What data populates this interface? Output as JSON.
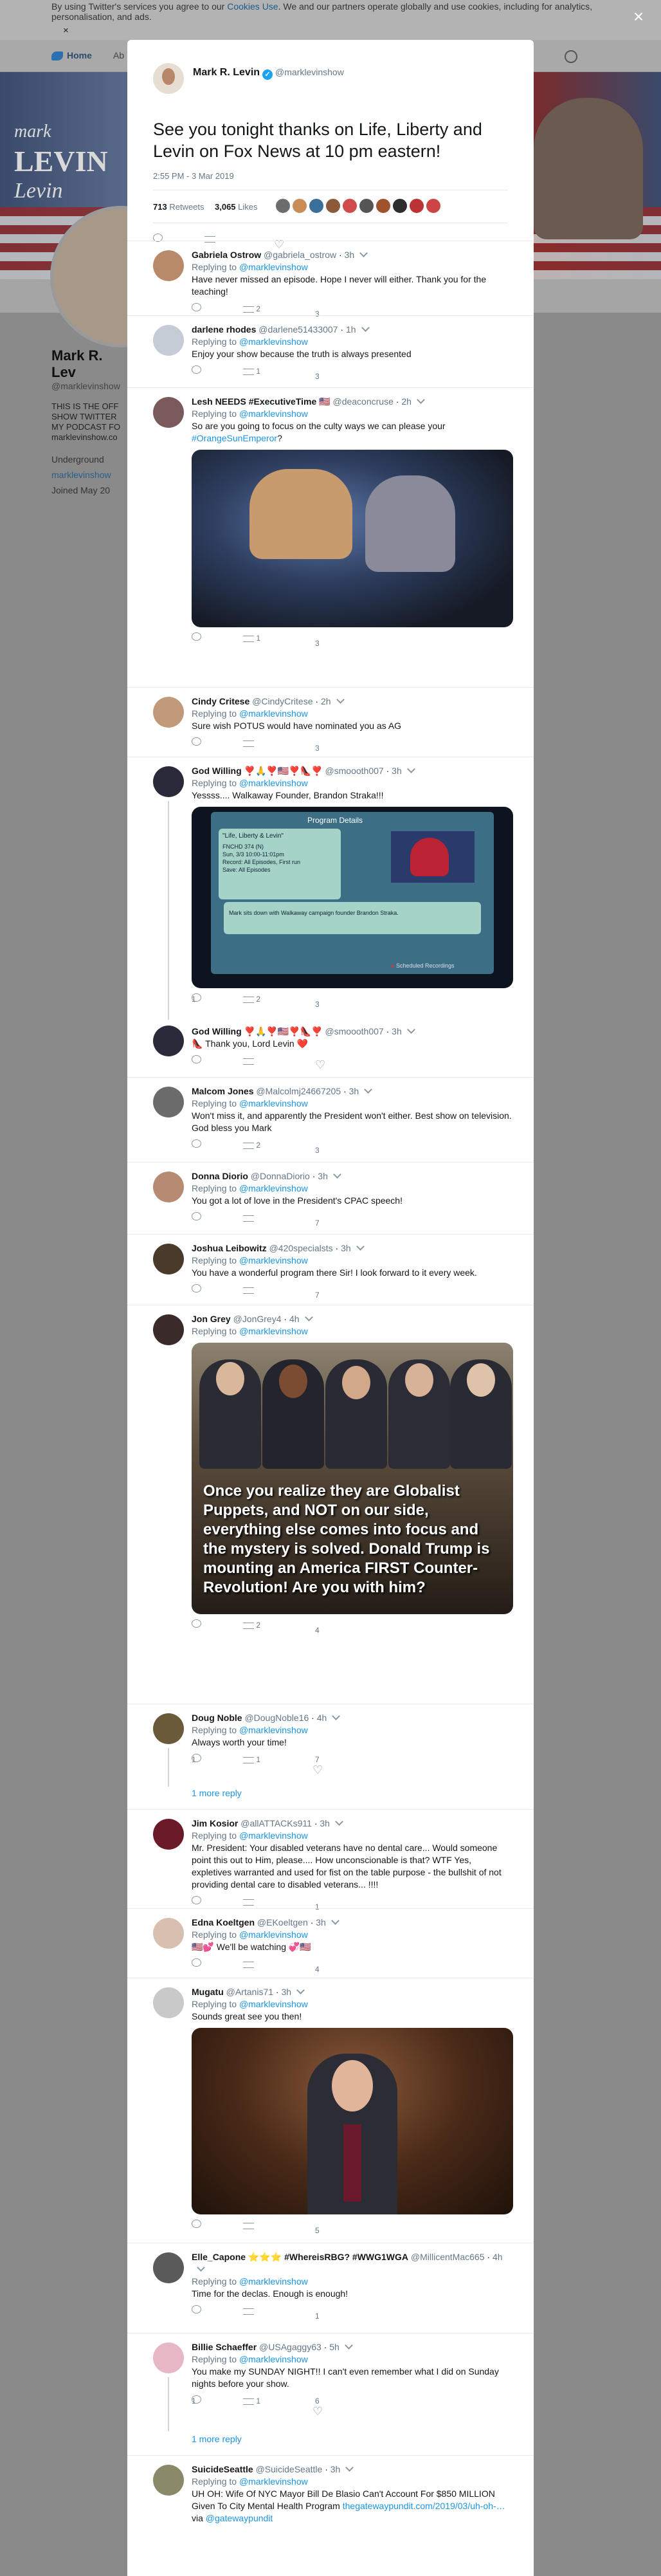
{
  "cookie_banner": {
    "text_before": "By using Twitter's services you agree to our ",
    "link": "Cookies Use",
    "text_after": ". We and our partners operate globally and use cookies, including for analytics, personalisation, and ads.",
    "close": "×"
  },
  "nav": {
    "home": "Home",
    "abbr": "Ab"
  },
  "background_profile": {
    "logo_line1": "mark",
    "logo_line2": "LEVIN",
    "logo_line3": "Levin",
    "name": "Mark R. Lev",
    "handle": "@marklevinshow",
    "bio": "THIS IS THE OFF SHOW TWITTER MY PODCAST FO marklevinshow.co",
    "location": "Underground",
    "site": "marklevinshow",
    "joined": "Joined May 20"
  },
  "modal_close": "×",
  "main_tweet": {
    "name": "Mark R. Levin",
    "handle": "@marklevinshow",
    "text": "See you tonight thanks on Life, Liberty and Levin on Fox News at 10 pm eastern!",
    "time": "2:55 PM - 3 Mar 2019",
    "retweets_count": "713",
    "retweets_label": "Retweets",
    "likes_count": "3,065",
    "likes_label": "Likes",
    "liker_colors": [
      "#6d6d6d",
      "#c98d5a",
      "#3a6f9a",
      "#8a5a3a",
      "#d14b4b",
      "#555555",
      "#a0522d",
      "#2e2e2e",
      "#b33",
      "#c44"
    ]
  },
  "replies": [
    {
      "name": "Gabriela Ostrow",
      "handle": "@gabriela_ostrow",
      "time": "3h",
      "replying": "Replying to",
      "to": "@marklevinshow",
      "text": "Have never missed an episode. Hope I never will either. Thank you for the teaching!",
      "c_reply": "",
      "c_rt": "2",
      "c_like": "3"
    },
    {
      "name": "darlene rhodes",
      "handle": "@darlene51433007",
      "time": "1h",
      "replying": "Replying to",
      "to": "@marklevinshow",
      "text": "Enjoy your show because the truth is always presented",
      "c_reply": "",
      "c_rt": "1",
      "c_like": "3"
    },
    {
      "name": "Lesh NEEDS #ExecutiveTime 🇺🇸",
      "handle": "@deaconcruse",
      "time": "2h",
      "replying": "Replying to",
      "to": "@marklevinshow",
      "text": "So are you going to focus on the culty ways we can please your ",
      "hashtag": "#OrangeSunEmperor",
      "text_end": "?",
      "c_reply": "",
      "c_rt": "1",
      "c_like": "3"
    },
    {
      "name": "Cindy Critese",
      "handle": "@CindyCritese",
      "time": "2h",
      "replying": "Replying to",
      "to": "@marklevinshow",
      "text": "Sure wish POTUS would have nominated you as AG",
      "c_reply": "",
      "c_rt": "",
      "c_like": "3"
    },
    {
      "name": "God Willing ❣️🙏❣️🇺🇸❣️👠❣️",
      "handle": "@smoooth007",
      "time": "3h",
      "replying": "Replying to",
      "to": "@marklevinshow",
      "text": "Yessss.... Walkaway Founder, Brandon Straka!!!",
      "c_reply": "1",
      "c_rt": "2",
      "c_like": "3",
      "screen_title": "Program Details",
      "screen_box_title": "\"Life, Liberty & Levin\"",
      "screen_box_lines": [
        "FNCHD 374 (N)",
        "Sun, 3/3 10:00-11:01pm",
        "Record: All Episodes, First run",
        "Save: All Episodes"
      ],
      "screen_desc": "Mark sits down with Walkaway campaign founder Brandon Straka.",
      "screen_footer": "Scheduled Recordings"
    },
    {
      "name": "God Willing ❣️🙏❣️🇺🇸❣️👠❣️",
      "handle": "@smoooth007",
      "time": "3h",
      "text": "👠 Thank you, Lord Levin ❤️",
      "c_reply": "",
      "c_rt": "",
      "c_like": ""
    },
    {
      "name": "Malcom Jones",
      "handle": "@Malcolmj24667205",
      "time": "3h",
      "replying": "Replying to",
      "to": "@marklevinshow",
      "text": "Won't miss it, and apparently the President won't either. Best show on television. God bless you Mark",
      "c_reply": "",
      "c_rt": "2",
      "c_like": "3"
    },
    {
      "name": "Donna Diorio",
      "handle": "@DonnaDiorio",
      "time": "3h",
      "replying": "Replying to",
      "to": "@marklevinshow",
      "text": "You got a lot of love in the President's CPAC speech!",
      "c_reply": "",
      "c_rt": "",
      "c_like": "7"
    },
    {
      "name": "Joshua Leibowitz",
      "handle": "@420specialsts",
      "time": "3h",
      "replying": "Replying to",
      "to": "@marklevinshow",
      "text": "You have a wonderful program there Sir! I look forward to it every week.",
      "c_reply": "",
      "c_rt": "",
      "c_like": "7"
    },
    {
      "name": "Jon Grey",
      "handle": "@JonGrey4",
      "time": "4h",
      "replying": "Replying to",
      "to": "@marklevinshow",
      "text": "",
      "c_reply": "",
      "c_rt": "2",
      "c_like": "4",
      "image_caption": "Once you realize they are Globalist Puppets, and NOT on our side, everything else comes into focus and the mystery is solved. Donald Trump is mounting an America FIRST  Counter-Revolution! Are you with him?"
    },
    {
      "name": "Doug Noble",
      "handle": "@DougNoble16",
      "time": "4h",
      "replying": "Replying to",
      "to": "@marklevinshow",
      "text": "Always worth your time!",
      "c_reply": "1",
      "c_rt": "1",
      "c_like": "7",
      "more": "1 more reply"
    },
    {
      "name": "Jim Kosior",
      "handle": "@allATTACKs911",
      "time": "3h",
      "replying": "Replying to",
      "to": "@marklevinshow",
      "text": "Mr. President: Your disabled veterans have no dental care... Would someone point this out to Him, please.... How unconscionable is that?  WTF  Yes, expletives warranted and used for fist on the table purpose - the bullshit of not providing dental care to disabled veterans... !!!!",
      "c_reply": "",
      "c_rt": "",
      "c_like": "1"
    },
    {
      "name": "Edna Koeltgen",
      "handle": "@EKoeltgen",
      "time": "3h",
      "replying": "Replying to",
      "to": "@marklevinshow",
      "text": "🇺🇸💕 We'll be watching 💞🇺🇸",
      "c_reply": "",
      "c_rt": "",
      "c_like": "4"
    },
    {
      "name": "Mugatu",
      "handle": "@Artanis71",
      "time": "3h",
      "replying": "Replying to",
      "to": "@marklevinshow",
      "text": "Sounds great see you then!",
      "c_reply": "",
      "c_rt": "",
      "c_like": "5"
    },
    {
      "name": "Elle_Capone ⭐⭐⭐ #WhereisRBG? #WWG1WGA",
      "handle": "@MillicentMac665",
      "time": "4h",
      "replying": "Replying to",
      "to": "@marklevinshow",
      "text": "Time for the declas. Enough is enough!",
      "c_reply": "",
      "c_rt": "",
      "c_like": "1"
    },
    {
      "name": "Billie Schaeffer",
      "handle": "@USAgaggy63",
      "time": "5h",
      "replying": "Replying to",
      "to": "@marklevinshow",
      "text": "You make my SUNDAY NIGHT!! I can't even remember what I did on Sunday nights before your show.",
      "c_reply": "1",
      "c_rt": "1",
      "c_like": "6",
      "more": "1 more reply"
    },
    {
      "name": "SuicideSeattle",
      "handle": "@SuicideSeattle",
      "time": "3h",
      "replying": "Replying to",
      "to": "@marklevinshow",
      "text": "UH OH: Wife Of NYC Mayor Bill De Blasio Can't Account For $850 MILLION Given To City Mental Health Program ",
      "link": "thegatewaypundit.com/2019/03/uh-oh-…",
      "via": "via ",
      "via_handle": "@gatewaypundit"
    }
  ]
}
